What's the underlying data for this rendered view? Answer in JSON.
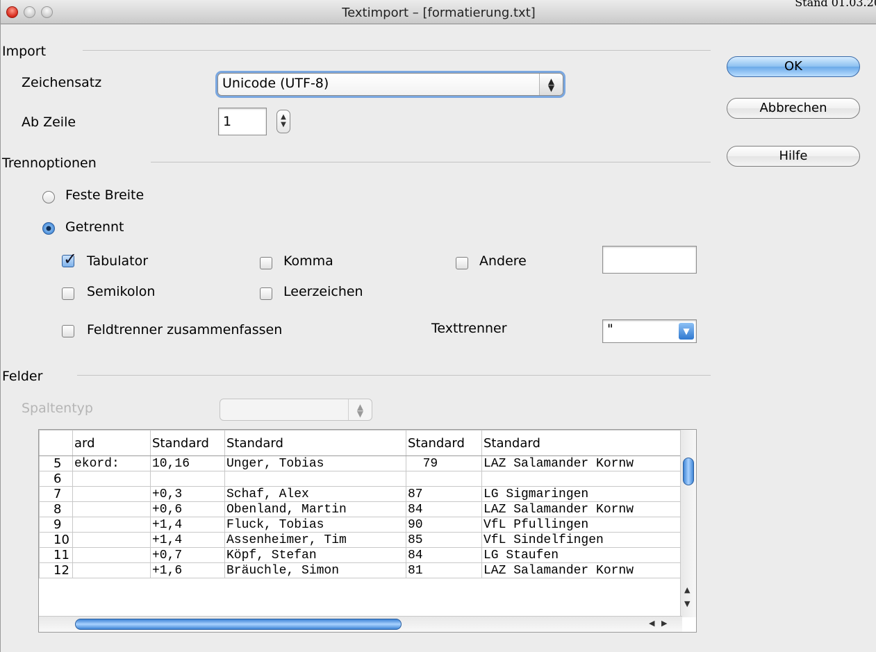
{
  "window": {
    "title": "Textimport – [formatierung.txt]",
    "corner_stamp": "Stand 01.03.20"
  },
  "import_section": {
    "header": "Import",
    "charset_label": "Zeichensatz",
    "charset_value": "Unicode (UTF-8)",
    "from_row_label": "Ab Zeile",
    "from_row_value": "1"
  },
  "separator_section": {
    "header": "Trennoptionen",
    "fixed_width_label": "Feste Breite",
    "separated_label": "Getrennt",
    "selected_mode": "Getrennt",
    "options": {
      "tab": {
        "label": "Tabulator",
        "checked": true
      },
      "comma": {
        "label": "Komma",
        "checked": false
      },
      "other": {
        "label": "Andere",
        "checked": false,
        "value": ""
      },
      "semicolon": {
        "label": "Semikolon",
        "checked": false
      },
      "space": {
        "label": "Leerzeichen",
        "checked": false
      },
      "merge": {
        "label": "Feldtrenner zusammenfassen",
        "checked": false
      }
    },
    "text_delimiter_label": "Texttrenner",
    "text_delimiter_value": "\""
  },
  "fields_section": {
    "header": "Felder",
    "column_type_label": "Spaltentyp",
    "column_type_value": ""
  },
  "table": {
    "headers": [
      "ard",
      "Standard",
      "Standard",
      "Standard",
      "Standard"
    ],
    "rows": [
      {
        "num": "5",
        "cells": [
          "ekord:",
          "10,16",
          "Unger, Tobias",
          "  79",
          "LAZ Salamander Kornw"
        ]
      },
      {
        "num": "6",
        "cells": [
          "",
          "",
          "",
          "",
          ""
        ]
      },
      {
        "num": "7",
        "cells": [
          "",
          "+0,3",
          "Schaf, Alex",
          "87",
          "LG Sigmaringen"
        ]
      },
      {
        "num": "8",
        "cells": [
          "",
          "+0,6",
          "Obenland, Martin",
          "84",
          "LAZ Salamander Kornw"
        ]
      },
      {
        "num": "9",
        "cells": [
          "",
          "+1,4",
          "Fluck, Tobias",
          "90",
          "VfL Pfullingen"
        ]
      },
      {
        "num": "10",
        "cells": [
          "",
          "+1,4",
          "Assenheimer, Tim",
          "85",
          "VfL Sindelfingen"
        ]
      },
      {
        "num": "11",
        "cells": [
          "",
          "+0,7",
          "Köpf, Stefan",
          "84",
          "LG Staufen"
        ]
      },
      {
        "num": "12",
        "cells": [
          "",
          "+1,6",
          "Bräuchle, Simon",
          "81",
          "LAZ Salamander Kornw"
        ]
      }
    ]
  },
  "buttons": {
    "ok": "OK",
    "cancel": "Abbrechen",
    "help": "Hilfe"
  },
  "icons": {
    "close": "close-icon",
    "minimize": "minimize-icon",
    "zoom": "zoom-icon",
    "checkmark": "checkmark-icon",
    "popup_arrows": "up-down-arrows-icon"
  },
  "colors": {
    "accent": "#6aa9e8",
    "close_light": "#d6281a",
    "window_bg": "#ececec"
  }
}
